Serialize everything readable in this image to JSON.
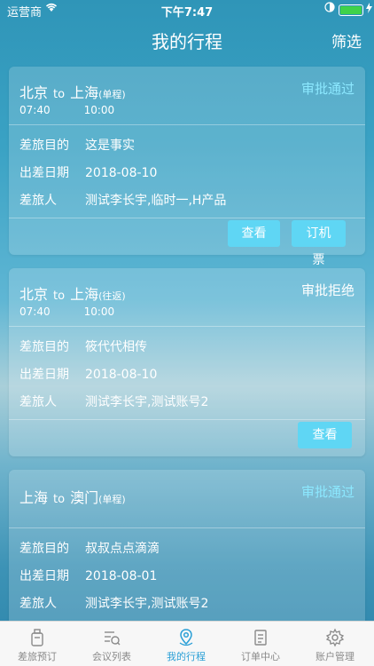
{
  "statusbar": {
    "carrier": "运营商",
    "time": "下午7:47"
  },
  "navbar": {
    "title": "我的行程",
    "filter_label": "筛选"
  },
  "labels": {
    "purpose": "差旅目的",
    "date": "出差日期",
    "travelers": "差旅人",
    "to": "to"
  },
  "trips": [
    {
      "from": "北京",
      "to_city": "上海",
      "trip_type": "(单程)",
      "status": "审批通过",
      "dep_time": "07:40",
      "arr_time": "10:00",
      "purpose": "这是事实",
      "date": "2018-08-10",
      "travelers": "测试李长宇,临时一,H产品",
      "buttons": [
        "查看",
        "订机票"
      ]
    },
    {
      "from": "北京",
      "to_city": "上海",
      "trip_type": "(往返)",
      "status": "审批拒绝",
      "dep_time": "07:40",
      "arr_time": "10:00",
      "purpose": "筱代代相传",
      "date": "2018-08-10",
      "travelers": "测试李长宇,测试账号2",
      "buttons": [
        "查看"
      ]
    },
    {
      "from": "上海",
      "to_city": "澳门",
      "trip_type": "(单程)",
      "status": "审批通过",
      "purpose": "叔叔点点滴滴",
      "date": "2018-08-01",
      "travelers": "测试李长宇,测试账号2"
    }
  ],
  "tabbar": {
    "items": [
      "差旅预订",
      "会议列表",
      "我的行程",
      "订单中心",
      "账户管理"
    ],
    "active": "我的行程"
  },
  "colors": {
    "accent": "#5fd6f4",
    "status_ok": "#8ce8ff",
    "tab_active": "#2a9fd6"
  }
}
